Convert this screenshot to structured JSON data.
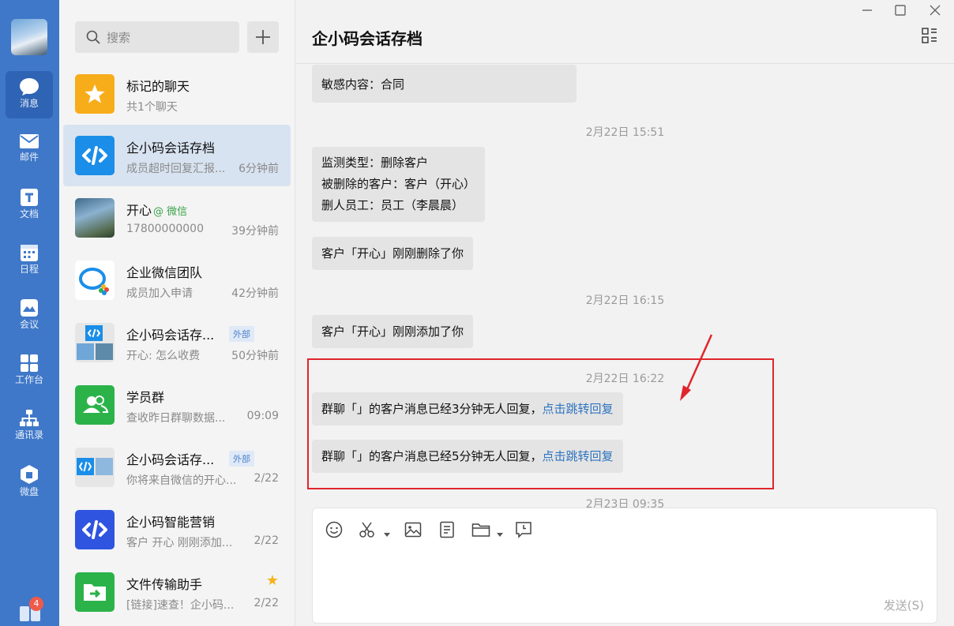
{
  "nav": {
    "items": [
      {
        "label": "消息",
        "icon": "chat-bubble-icon"
      },
      {
        "label": "邮件",
        "icon": "mail-icon"
      },
      {
        "label": "文档",
        "icon": "document-icon"
      },
      {
        "label": "日程",
        "icon": "calendar-icon"
      },
      {
        "label": "会议",
        "icon": "meeting-icon"
      },
      {
        "label": "工作台",
        "icon": "workbench-icon"
      },
      {
        "label": "通讯录",
        "icon": "contacts-icon"
      },
      {
        "label": "微盘",
        "icon": "drive-icon"
      }
    ],
    "badge": "4"
  },
  "search": {
    "placeholder": "搜索"
  },
  "chats": [
    {
      "name": "标记的聊天",
      "sub": "共1个聊天",
      "time": ""
    },
    {
      "name": "企小码会话存档",
      "sub": "成员超时回复汇报...",
      "time": "6分钟前"
    },
    {
      "name": "开心",
      "wechat": "@ 微信",
      "sub": "17800000000",
      "time": "39分钟前"
    },
    {
      "name": "企业微信团队",
      "sub": "成员加入申请",
      "time": "42分钟前"
    },
    {
      "name": "企小码会话存...",
      "tag": "外部",
      "sub": "开心: 怎么收费",
      "time": "50分钟前"
    },
    {
      "name": "学员群",
      "sub": "查收昨日群聊数据...",
      "time": "09:09"
    },
    {
      "name": "企小码会话存...",
      "tag": "外部",
      "sub": "你将来自微信的开心...",
      "time": "2/22"
    },
    {
      "name": "企小码智能营销",
      "sub": "客户 开心 刚刚添加...",
      "time": "2/22"
    },
    {
      "name": "文件传输助手",
      "sub": "[链接]速查！企小码...",
      "time": "2/22"
    }
  ],
  "main": {
    "title": "企小码会话存档",
    "messages": {
      "m1": "敏感内容：合同",
      "ts1": "2月22日 15:51",
      "m2a": "监测类型：删除客户",
      "m2b": "被删除的客户：客户（开心）",
      "m2c": "删人员工：员工（李晨晨）",
      "m3": "客户「开心」刚刚删除了你",
      "ts2": "2月22日 16:15",
      "m4": "客户「开心」刚刚添加了你",
      "ts3": "2月22日 16:22",
      "m5": "群聊「」的客户消息已经3分钟无人回复，",
      "m5link": "点击跳转回复",
      "m6": "群聊「」的客户消息已经5分钟无人回复，",
      "m6link": "点击跳转回复",
      "ts4": "2月23日 09:35"
    },
    "send_label": "发送(S)"
  }
}
